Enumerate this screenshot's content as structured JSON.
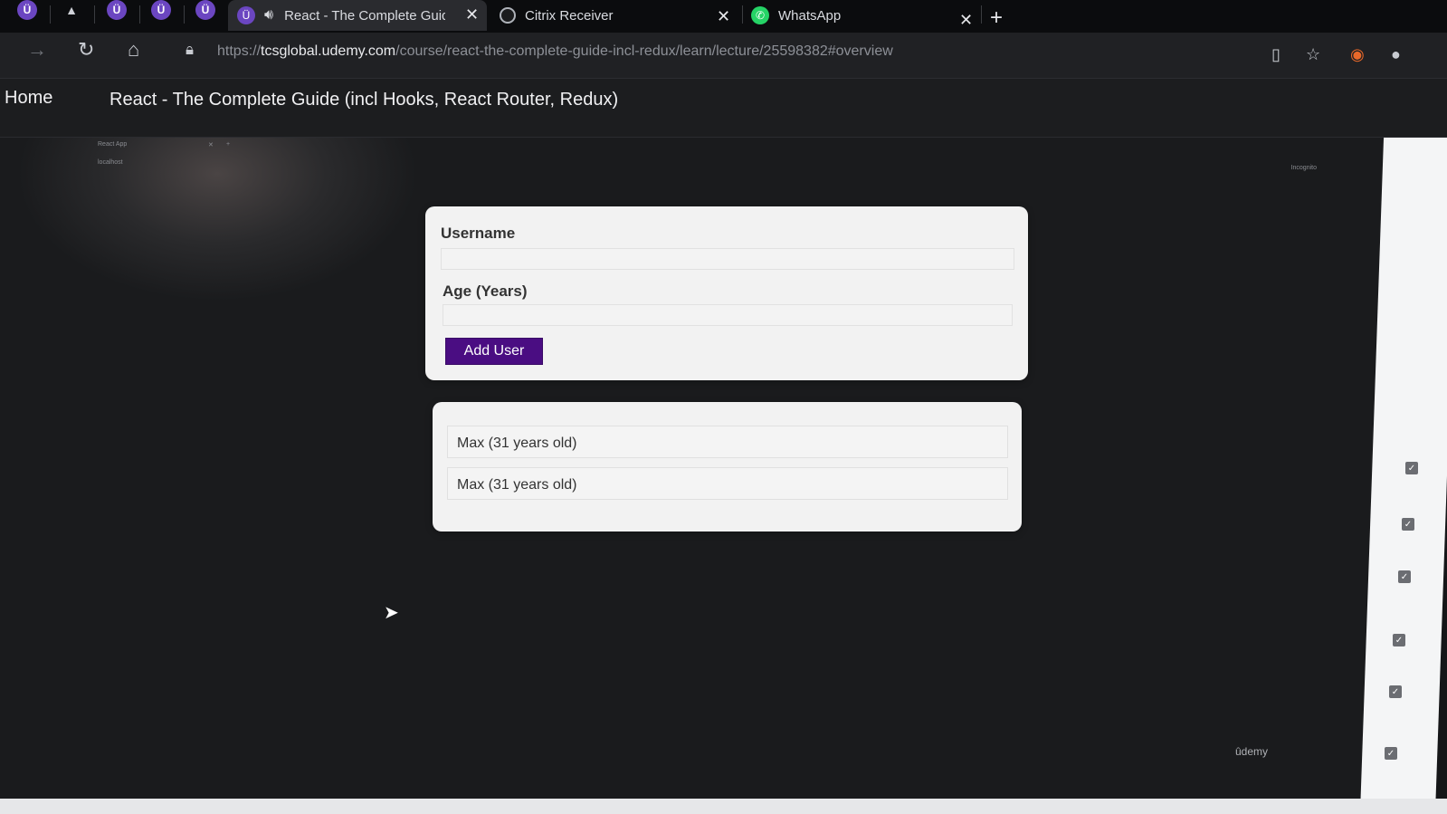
{
  "browser": {
    "tabs": [
      {
        "title": "React - The Complete Guid",
        "active": true,
        "icon": "udemy-icon",
        "audio": true
      },
      {
        "title": "Citrix Receiver",
        "active": false,
        "icon": "citrix-icon"
      },
      {
        "title": "WhatsApp",
        "active": false,
        "icon": "whatsapp-icon"
      }
    ],
    "close_glyph": "✕",
    "new_tab_glyph": "+",
    "pinned_icons": [
      "udemy-icon",
      "mountain-icon",
      "udemy-icon",
      "udemy-icon",
      "udemy-icon",
      "udemy-icon"
    ],
    "address": {
      "scheme": "https://",
      "host": "tcsglobal.udemy.com",
      "path": "/course/react-the-complete-guide-incl-redux/learn/lecture/25598382#overview"
    }
  },
  "course_header": {
    "home_label": "Home",
    "title": "React - The Complete Guide (incl Hooks, React Router, Redux)"
  },
  "embedded_app": {
    "mini_browser": {
      "tab_title": "React App",
      "url": "localhost",
      "profile_label": "Incognito"
    },
    "form": {
      "username_label": "Username",
      "username_value": "",
      "age_label": "Age (Years)",
      "age_value": "",
      "submit_label": "Add User"
    },
    "users": [
      {
        "text": "Max (31 years old)"
      },
      {
        "text": "Max (31 years old)"
      }
    ]
  },
  "watermark": "ûdemy",
  "colors": {
    "button_bg": "#4a0d82",
    "card_bg": "#f2f2f2",
    "page_bg": "#1c1d1f"
  }
}
